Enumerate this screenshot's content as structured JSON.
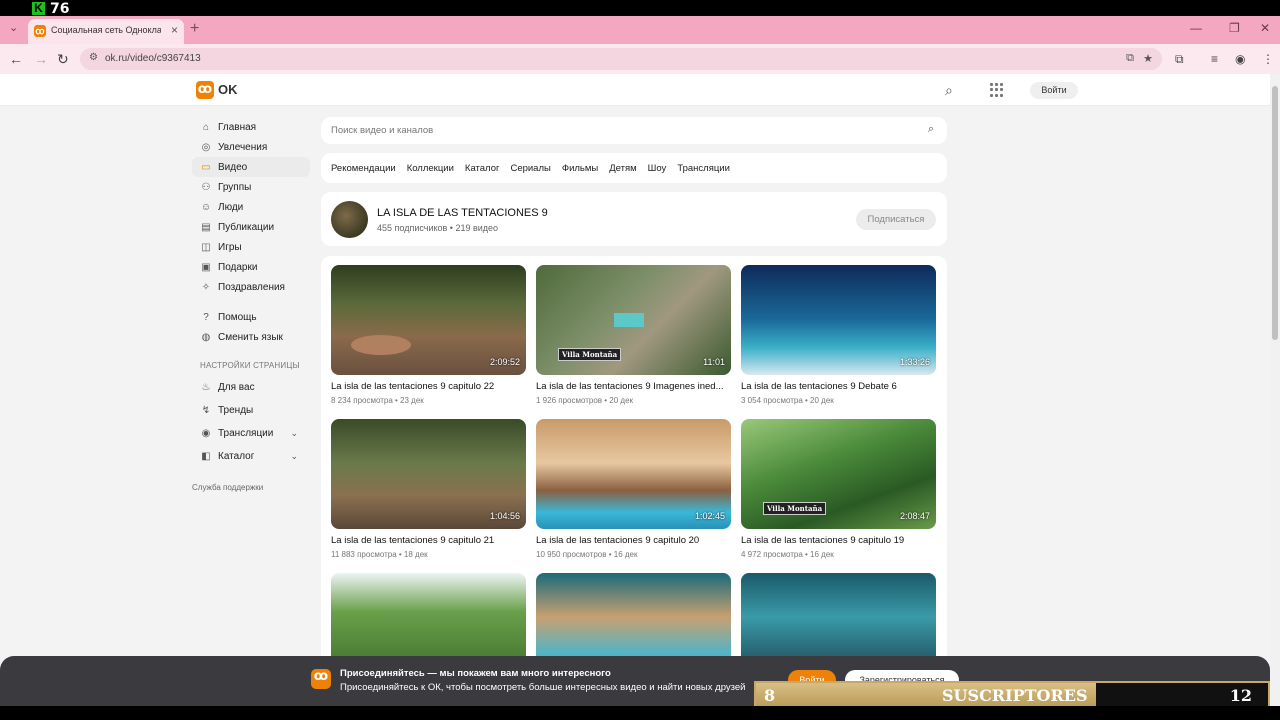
{
  "overlay": {
    "logo_letter": "K",
    "count": "76"
  },
  "browser": {
    "tab_title": "Социальная сеть Одноклассники",
    "url": "ok.ru/video/c9367413"
  },
  "header": {
    "logo_text": "OK",
    "login_label": "Войти"
  },
  "sidebar": {
    "items": [
      {
        "label": "Главная",
        "icon": "home-icon"
      },
      {
        "label": "Увлечения",
        "icon": "hobby-icon"
      },
      {
        "label": "Видео",
        "icon": "video-icon"
      },
      {
        "label": "Группы",
        "icon": "groups-icon"
      },
      {
        "label": "Люди",
        "icon": "people-icon"
      },
      {
        "label": "Публикации",
        "icon": "publications-icon"
      },
      {
        "label": "Игры",
        "icon": "games-icon"
      },
      {
        "label": "Подарки",
        "icon": "gifts-icon"
      },
      {
        "label": "Поздравления",
        "icon": "congrats-icon"
      }
    ],
    "help": {
      "label": "Помощь"
    },
    "language": {
      "label": "Сменить язык"
    },
    "section_title": "НАСТРОЙКИ СТРАНИЦЫ",
    "settings": [
      {
        "label": "Для вас"
      },
      {
        "label": "Тренды"
      },
      {
        "label": "Трансляции"
      },
      {
        "label": "Каталог"
      }
    ],
    "support": "Служба поддержки"
  },
  "search": {
    "placeholder": "Поиск видео и каналов"
  },
  "nav_tabs": [
    "Рекомендации",
    "Коллекции",
    "Каталог",
    "Сериалы",
    "Фильмы",
    "Детям",
    "Шоу",
    "Трансляции"
  ],
  "channel": {
    "name": "LA ISLA DE LAS TENTACIONES 9",
    "stats": "455 подписчиков • 219 видео",
    "subscribe_label": "Подписаться"
  },
  "videos": [
    {
      "title": "La isla de las tentaciones 9 capitulo 22",
      "meta": "8 234 просмотра • 23 дек",
      "duration": "2:09:52"
    },
    {
      "title": "La isla de las tentaciones 9 Imagenes ined...",
      "meta": "1 926 просмотров • 20 дек",
      "duration": "11:01",
      "watermark": "Villa Montaña"
    },
    {
      "title": "La isla de las tentaciones 9 Debate 6",
      "meta": "3 054 просмотра • 20 дек",
      "duration": "1:33:26"
    },
    {
      "title": "La isla de las tentaciones 9 capitulo 21",
      "meta": "11 883 просмотра • 18 дек",
      "duration": "1:04:56"
    },
    {
      "title": "La isla de las tentaciones 9 capitulo 20",
      "meta": "10 950 просмотров • 16 дек",
      "duration": "1:02:45"
    },
    {
      "title": "La isla de las tentaciones 9 capitulo 19",
      "meta": "4 972 просмотра • 16 дек",
      "duration": "2:08:47",
      "watermark": "Villa Montaña"
    }
  ],
  "banner": {
    "title": "Присоединяйтесь — мы покажем вам много интересного",
    "text": "Присоединяйтесь к ОК, чтобы посмотреть больше интересных видео и найти новых друзей",
    "login_label": "Войти",
    "register_label": "Зарегистрироваться"
  },
  "subscribers_bar": {
    "left": "8",
    "label": "SUSCRIPTORES",
    "right": "12"
  }
}
